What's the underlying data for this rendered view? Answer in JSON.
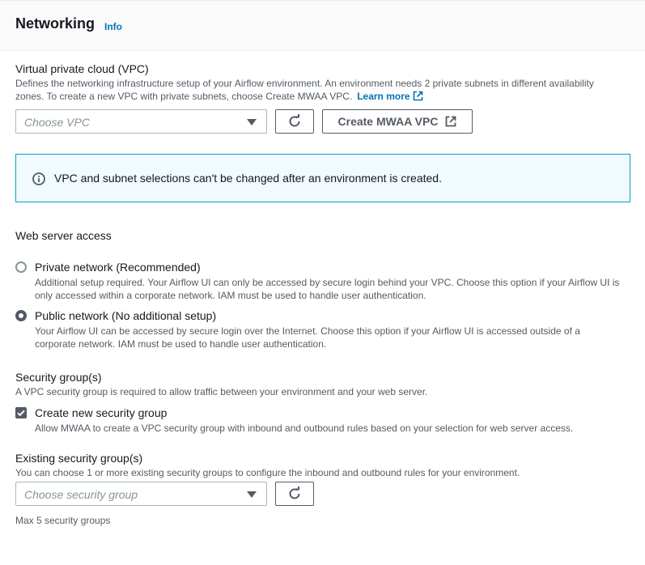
{
  "section": {
    "title": "Networking",
    "info": "Info"
  },
  "vpc": {
    "label": "Virtual private cloud (VPC)",
    "description_line1": "Defines the networking infrastructure setup of your Airflow environment. An environment needs 2 private subnets in different availability",
    "description_line2": "zones. To create a new VPC with private subnets, choose Create MWAA VPC.",
    "learn_more": "Learn more",
    "select_placeholder": "Choose VPC",
    "create_button": "Create MWAA VPC"
  },
  "alert": {
    "text": "VPC and subnet selections can't be changed after an environment is created."
  },
  "web_server": {
    "label": "Web server access",
    "options": [
      {
        "label": "Private network (Recommended)",
        "desc_line1": "Additional setup required. Your Airflow UI can only be accessed by secure login behind your VPC. Choose this option if your Airflow UI is",
        "desc_line2": "only accessed within a corporate network. IAM must be used to handle user authentication.",
        "selected": false
      },
      {
        "label": "Public network (No additional setup)",
        "desc_line1": "Your Airflow UI can be accessed by secure login over the Internet. Choose this option if your Airflow UI is accessed outside of a",
        "desc_line2": "corporate network. IAM must be used to handle user authentication.",
        "selected": true
      }
    ]
  },
  "security_groups": {
    "label": "Security group(s)",
    "description": "A VPC security group is required to allow traffic between your environment and your web server.",
    "create_new_label": "Create new security group",
    "create_new_desc": "Allow MWAA to create a VPC security group with inbound and outbound rules based on your selection for web server access.",
    "create_new_checked": true
  },
  "existing_groups": {
    "label": "Existing security group(s)",
    "description": "You can choose 1 or more existing security groups to configure the inbound and outbound rules for your environment.",
    "select_placeholder": "Choose security group",
    "hint": "Max 5 security groups"
  },
  "colors": {
    "link": "#0073bb",
    "alert_border": "#00a1c9",
    "alert_bg": "#f1faff",
    "control": "#545b64"
  },
  "icons": [
    "external-link-icon",
    "refresh-icon",
    "info-circle-icon",
    "caret-down-icon"
  ]
}
